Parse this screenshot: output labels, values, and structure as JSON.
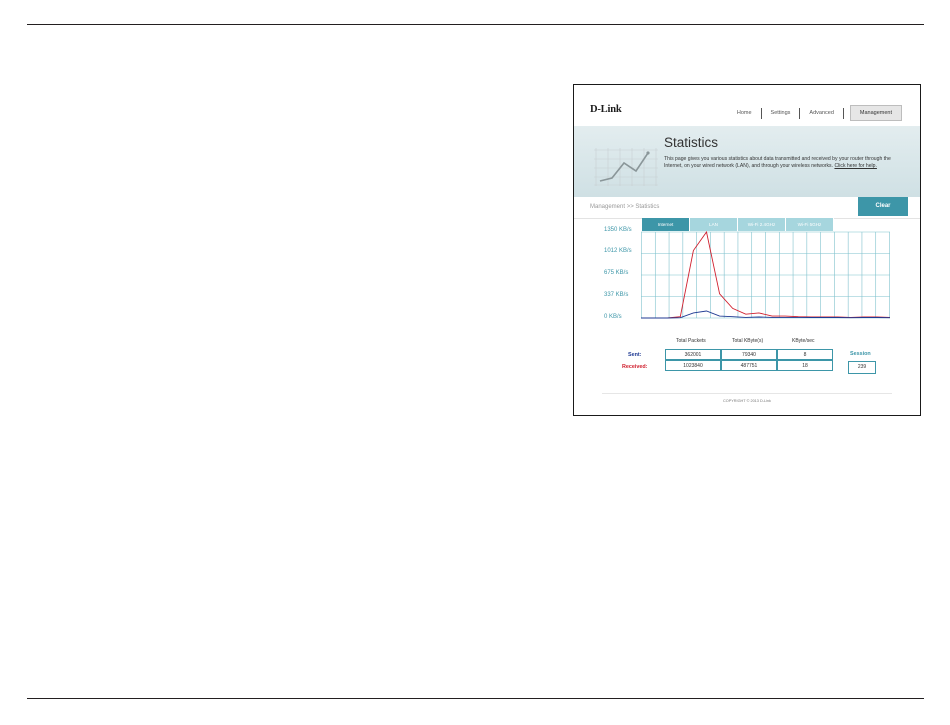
{
  "brand": {
    "logo": "D-Link"
  },
  "nav": {
    "items": [
      "Home",
      "Settings",
      "Advanced",
      "Management"
    ],
    "active": "Management"
  },
  "banner": {
    "title": "Statistics",
    "description": "This page gives you various statistics about data transmitted and received by your router through the Internet, on your wired network (LAN), and through your wireless networks.",
    "help_link": "Click here for help."
  },
  "breadcrumb": "Management >> Statistics",
  "clear_button": "Clear",
  "tabs": [
    "Internet",
    "LAN",
    "Wi-Fi 2.4GHz",
    "Wi-Fi 5GHz"
  ],
  "active_tab": "Internet",
  "chart_data": {
    "type": "line",
    "yticks": [
      "1350 KB/s",
      "1012 KB/s",
      "675 KB/s",
      "337 KB/s",
      "0 KB/s"
    ],
    "ylim": [
      0,
      1350
    ],
    "grid": true,
    "series": [
      {
        "color": "#d0202e",
        "values": [
          0,
          0,
          0,
          20,
          1060,
          1350,
          380,
          150,
          60,
          80,
          30,
          30,
          20,
          15,
          15,
          15,
          10,
          15,
          15,
          10
        ]
      },
      {
        "color": "#1f3a93",
        "values": [
          0,
          0,
          0,
          5,
          80,
          110,
          30,
          20,
          10,
          15,
          10,
          10,
          10,
          8,
          8,
          8,
          5,
          8,
          8,
          5
        ]
      }
    ]
  },
  "stats": {
    "headers": [
      "Total Packets",
      "Total KByte(s)",
      "KByte/sec"
    ],
    "rows": [
      {
        "label": "Sent:",
        "color": "#1f3a93",
        "values": [
          "362001",
          "79340",
          "8"
        ]
      },
      {
        "label": "Received:",
        "color": "#d0202e",
        "values": [
          "1023840",
          "487751",
          "18"
        ]
      }
    ],
    "session_label": "Session",
    "session_value": "239"
  },
  "footer": {
    "copyright": "COPYRIGHT © 2013 D-Link"
  },
  "colors": {
    "accent": "#3d96a8",
    "tab_inactive": "#a6d6de",
    "sent": "#1f3a93",
    "received": "#d0202e"
  }
}
